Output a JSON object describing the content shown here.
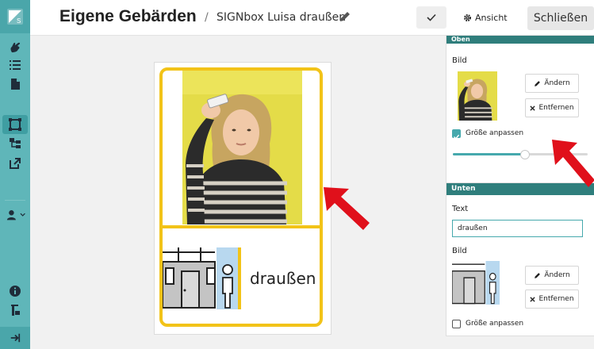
{
  "header": {
    "title": "Eigene Gebärden",
    "separator": "/",
    "breadcrumb": "SIGNbox Luisa draußen",
    "view_label": "Ansicht",
    "close_label": "Schließen"
  },
  "sidebar": {
    "items": [
      {
        "icon": "hand-icon"
      },
      {
        "icon": "list-icon"
      },
      {
        "icon": "document-icon"
      },
      {
        "icon": "frame-icon",
        "active": true
      },
      {
        "icon": "hierarchy-icon"
      },
      {
        "icon": "external-link-icon"
      },
      {
        "icon": "user-icon"
      },
      {
        "icon": "info-icon"
      },
      {
        "icon": "sign-icon"
      },
      {
        "icon": "logout-icon"
      }
    ]
  },
  "card": {
    "word": "draußen"
  },
  "panel": {
    "top_section": {
      "header": "Oben",
      "image_label": "Bild",
      "change_label": "Ändern",
      "remove_label": "Entfernen",
      "fit_label": "Größe anpassen",
      "fit_checked": true,
      "size_fraction": 0.53
    },
    "bottom_section": {
      "header": "Unten",
      "text_label": "Text",
      "text_value": "draußen",
      "image_label": "Bild",
      "change_label": "Ändern",
      "remove_label": "Entfernen",
      "fit_label": "Größe anpassen",
      "fit_checked": false
    }
  },
  "colors": {
    "sidebar": "#5fb6b9",
    "section_header": "#2f7e7c",
    "card_border": "#f2c318",
    "accent": "#46a9ad",
    "arrow": "#e0101b"
  }
}
